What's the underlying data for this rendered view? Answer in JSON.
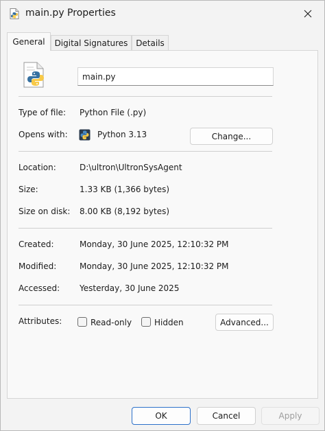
{
  "window": {
    "title": "main.py Properties",
    "close_icon": "close-icon",
    "title_icon": "python-file-icon"
  },
  "tabs": [
    {
      "label": "General",
      "active": true
    },
    {
      "label": "Digital Signatures",
      "active": false
    },
    {
      "label": "Details",
      "active": false
    }
  ],
  "general": {
    "file_name": "main.py",
    "type_label": "Type of file:",
    "type_value": "Python File (.py)",
    "opens_label": "Opens with:",
    "opens_value": "Python 3.13",
    "change_button": "Change...",
    "location_label": "Location:",
    "location_value": "D:\\ultron\\UltronSysAgent",
    "size_label": "Size:",
    "size_value": "1.33 KB (1,366 bytes)",
    "size_disk_label": "Size on disk:",
    "size_disk_value": "8.00 KB (8,192 bytes)",
    "created_label": "Created:",
    "created_value": "Monday, 30 June 2025, 12:10:32 PM",
    "modified_label": "Modified:",
    "modified_value": "Monday, 30 June 2025, 12:10:32 PM",
    "accessed_label": "Accessed:",
    "accessed_value": "Yesterday, 30 June 2025",
    "attributes_label": "Attributes:",
    "readonly_label": "Read-only",
    "readonly_checked": false,
    "hidden_label": "Hidden",
    "hidden_checked": false,
    "advanced_button": "Advanced..."
  },
  "footer": {
    "ok": "OK",
    "cancel": "Cancel",
    "apply": "Apply"
  },
  "colors": {
    "accent": "#2a6fc9",
    "python_blue": "#3771a1",
    "python_yellow": "#f7c948"
  }
}
